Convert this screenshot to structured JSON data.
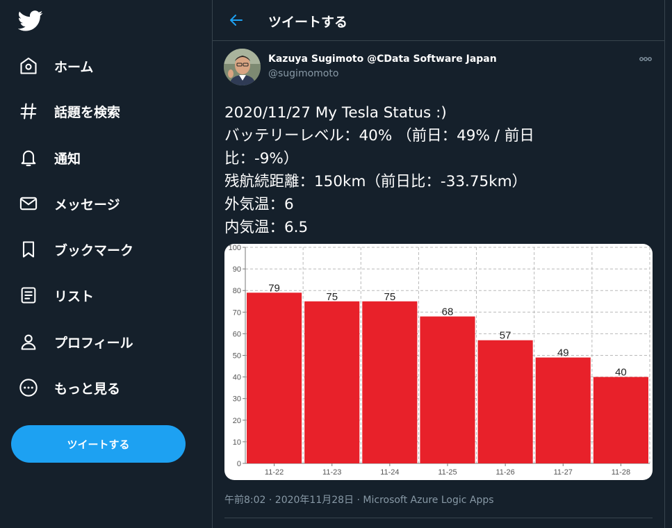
{
  "sidebar": {
    "items": [
      {
        "label": "ホーム",
        "icon": "home-icon"
      },
      {
        "label": "話題を検索",
        "icon": "hashtag-icon"
      },
      {
        "label": "通知",
        "icon": "bell-icon"
      },
      {
        "label": "メッセージ",
        "icon": "mail-icon"
      },
      {
        "label": "ブックマーク",
        "icon": "bookmark-icon"
      },
      {
        "label": "リスト",
        "icon": "list-icon"
      },
      {
        "label": "プロフィール",
        "icon": "profile-icon"
      },
      {
        "label": "もっと見る",
        "icon": "more-circle-icon"
      }
    ],
    "tweet_button": "ツイートする"
  },
  "header": {
    "title": "ツイートする"
  },
  "tweet": {
    "author_name": "Kazuya Sugimoto @CData Software Japan",
    "author_handle": "@sugimomoto",
    "lines": [
      "2020/11/27 My Tesla Status :)",
      "バッテリーレベル：40% （前日：49% /  前日",
      "比：-9%）",
      "残航続距離：150km（前日比：-33.75km）",
      "外気温：6",
      "内気温：6.5"
    ],
    "meta": "午前8:02 · 2020年11月28日 · Microsoft Azure Logic Apps"
  },
  "colors": {
    "background": "#15202b",
    "accent": "#1da1f2",
    "bar": "#e8212a",
    "muted": "#8899a6"
  },
  "chart_data": {
    "type": "bar",
    "categories": [
      "11-22",
      "11-23",
      "11-24",
      "11-25",
      "11-26",
      "11-27",
      "11-28"
    ],
    "values": [
      79,
      75,
      75,
      68,
      57,
      49,
      40
    ],
    "yticks": [
      0,
      10,
      20,
      30,
      40,
      50,
      60,
      70,
      80,
      90,
      100
    ],
    "ylim": [
      0,
      100
    ],
    "grid": true,
    "data_labels": true,
    "title": "",
    "xlabel": "",
    "ylabel": ""
  }
}
